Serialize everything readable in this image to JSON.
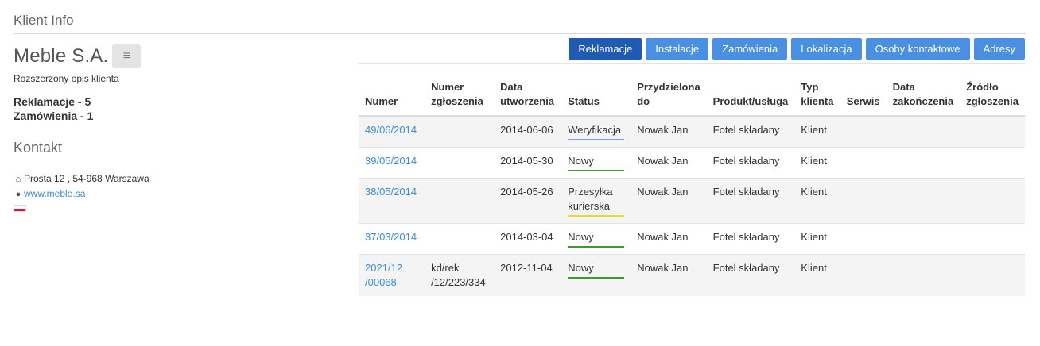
{
  "header": {
    "title": "Klient Info"
  },
  "client": {
    "name": "Meble S.A.",
    "menu_icon": "bars-icon",
    "description": "Rozszerzony opis klienta",
    "complaints_count": "Reklamacje - 5",
    "orders_count": "Zamówienia - 1"
  },
  "contact": {
    "title": "Kontakt",
    "address": "Prosta 12 , 54-968 Warszawa",
    "website": "www.meble.sa",
    "address_icon": "home-icon",
    "website_icon": "globe-icon",
    "flag": "poland-flag-icon"
  },
  "tabs": [
    {
      "label": "Reklamacje",
      "active": true
    },
    {
      "label": "Instalacje",
      "active": false
    },
    {
      "label": "Zamówienia",
      "active": false
    },
    {
      "label": "Lokalizacja",
      "active": false
    },
    {
      "label": "Osoby kontaktowe",
      "active": false
    },
    {
      "label": "Adresy",
      "active": false
    }
  ],
  "table": {
    "columns": [
      {
        "key": "numer",
        "label": "Numer",
        "width": 88
      },
      {
        "key": "numer_zgloszenia",
        "label": "Numer zgłoszenia",
        "width": 93
      },
      {
        "key": "data_utworzenia",
        "label": "Data utworzenia",
        "width": 88
      },
      {
        "key": "status",
        "label": "Status",
        "width": 87
      },
      {
        "key": "przydzielona_do",
        "label": "Przydzielona do",
        "width": 93
      },
      {
        "key": "produkt",
        "label": "Produkt/usługa",
        "width": 107
      },
      {
        "key": "typ_klienta",
        "label": "Typ klienta",
        "width": 58
      },
      {
        "key": "serwis",
        "label": "Serwis",
        "width": 55
      },
      {
        "key": "data_zakonczenia",
        "label": "Data zakończenia",
        "width": 90
      },
      {
        "key": "zrodlo",
        "label": "Źródło zgłoszenia",
        "width": 79
      }
    ],
    "rows": [
      {
        "numer": "49/06/2014",
        "numer_zgloszenia": "",
        "data_utworzenia": "2014-06-06",
        "status": "Weryfikacja",
        "status_color": "#7e9fd8",
        "przydzielona_do": "Nowak Jan",
        "produkt": "Fotel składany",
        "typ_klienta": "Klient",
        "serwis": "",
        "data_zakonczenia": "",
        "zrodlo": ""
      },
      {
        "numer": "39/05/2014",
        "numer_zgloszenia": "",
        "data_utworzenia": "2014-05-30",
        "status": "Nowy",
        "status_color": "#3a9a2c",
        "przydzielona_do": "Nowak Jan",
        "produkt": "Fotel składany",
        "typ_klienta": "Klient",
        "serwis": "",
        "data_zakonczenia": "",
        "zrodlo": ""
      },
      {
        "numer": "38/05/2014",
        "numer_zgloszenia": "",
        "data_utworzenia": "2014-05-26",
        "status": "Przesyłka kurierska",
        "status_color": "#e8d83c",
        "przydzielona_do": "Nowak Jan",
        "produkt": "Fotel składany",
        "typ_klienta": "Klient",
        "serwis": "",
        "data_zakonczenia": "",
        "zrodlo": ""
      },
      {
        "numer": "37/03/2014",
        "numer_zgloszenia": "",
        "data_utworzenia": "2014-03-04",
        "status": "Nowy",
        "status_color": "#3a9a2c",
        "przydzielona_do": "Nowak Jan",
        "produkt": "Fotel składany",
        "typ_klienta": "Klient",
        "serwis": "",
        "data_zakonczenia": "",
        "zrodlo": ""
      },
      {
        "numer": "2021/12 /00068",
        "numer_zgloszenia": "kd/rek /12/223/334",
        "data_utworzenia": "2012-11-04",
        "status": "Nowy",
        "status_color": "#3a9a2c",
        "przydzielona_do": "Nowak Jan",
        "produkt": "Fotel składany",
        "typ_klienta": "Klient",
        "serwis": "",
        "data_zakonczenia": "",
        "zrodlo": ""
      }
    ]
  }
}
